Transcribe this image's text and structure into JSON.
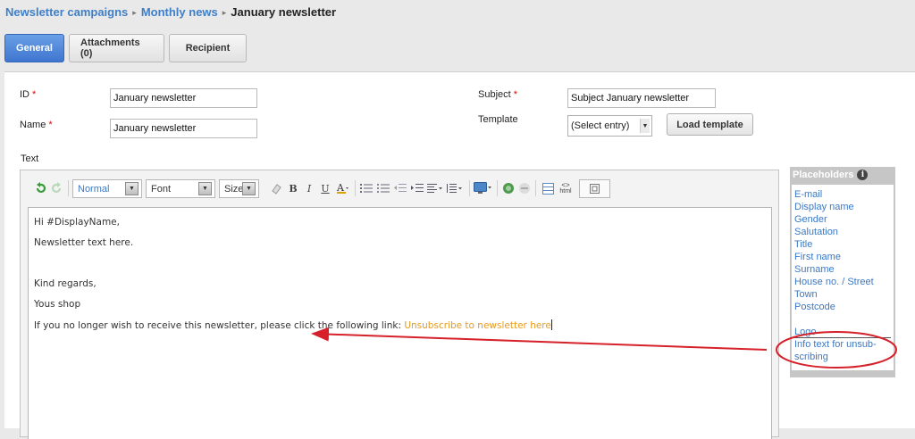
{
  "breadcrumb": {
    "items": [
      "Newsletter campaigns",
      "Monthly news"
    ],
    "separator": "▸",
    "current": "January newsletter"
  },
  "tabs": [
    {
      "label": "General",
      "active": true
    },
    {
      "label": "Attachments (0)",
      "active": false
    },
    {
      "label": "Recipient",
      "active": false
    }
  ],
  "form": {
    "id_label": "ID",
    "id_value": "January newsletter",
    "name_label": "Name",
    "name_value": "January newsletter",
    "subject_label": "Subject",
    "subject_value": "Subject January newsletter",
    "template_label": "Template",
    "template_value": "(Select entry)",
    "load_template_label": "Load template",
    "required_mark": "*",
    "text_label": "Text"
  },
  "editor": {
    "format_value": "Normal",
    "font_value": "Font",
    "size_value": "Size",
    "bold": "B",
    "italic": "I",
    "underline": "U",
    "html_label": "html",
    "lines": {
      "greeting": "Hi #DisplayName,",
      "body": "Newsletter text here.",
      "regards": "Kind regards,",
      "signature": "Yous shop",
      "unsubscribe_text": "If you no longer wish to receive this newsletter, please click the following link: ",
      "unsubscribe_link": "Unsubscribe to newsletter here"
    }
  },
  "placeholders": {
    "title": "Placeholders",
    "info": "i",
    "items": [
      "E-mail",
      "Display name",
      "Gender",
      "Salutation",
      "Title",
      "First name",
      "Surname",
      "House no. / Street",
      "Town",
      "Postcode"
    ],
    "extra_items": [
      "Logo",
      "Info text for unsub-",
      "scribing"
    ]
  },
  "colors": {
    "accent": "#3f75cf",
    "link": "#3b79c6",
    "unsubscribe_link": "#e89a1f",
    "annotation": "#d6202a"
  },
  "icons": [
    "undo-icon",
    "redo-icon",
    "eraser-icon",
    "text-color-icon",
    "numbered-list-icon",
    "bullet-list-icon",
    "outdent-icon",
    "indent-icon",
    "align-icon",
    "line-spacing-icon",
    "monitor-icon",
    "link-icon",
    "unlink-icon",
    "table-icon",
    "source-icon",
    "fullscreen-icon",
    "info-icon",
    "arrow-annotation",
    "circle-annotation"
  ]
}
